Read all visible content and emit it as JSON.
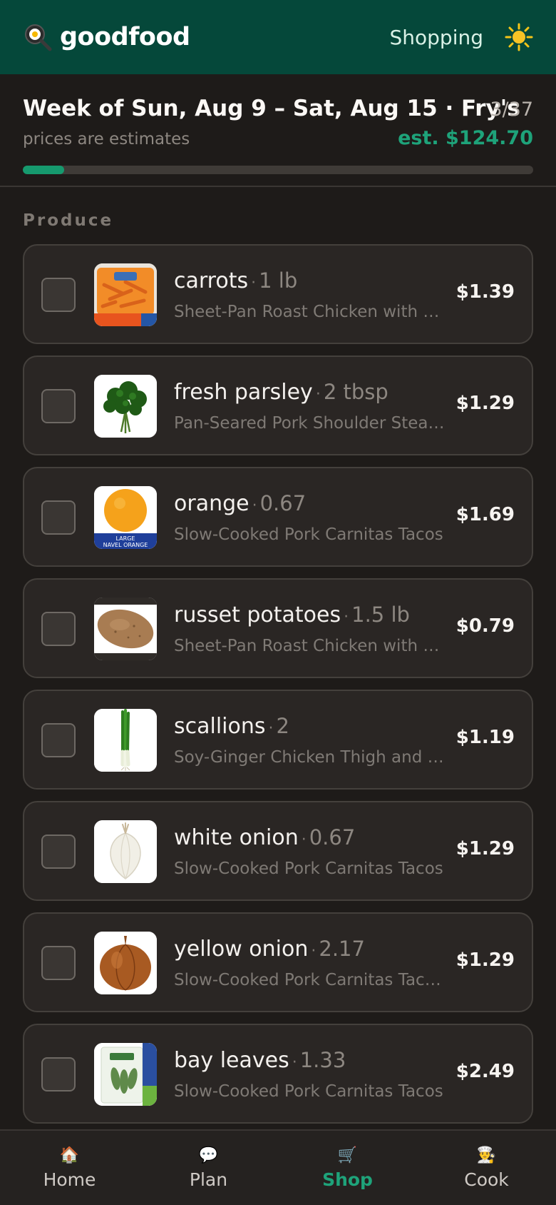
{
  "app": {
    "name": "goodfood",
    "mode": "Shopping"
  },
  "colors": {
    "topbar": "#05483a",
    "accent": "#1ea37a",
    "background": "#1e1b19",
    "card": "#2a2624"
  },
  "header": {
    "week": "Week of Sun, Aug 9 – Sat, Aug 15 · Fry's",
    "count": "3/37",
    "note": "prices are estimates",
    "estimate": "est. $124.70",
    "progress": 0.081
  },
  "section": {
    "title": "Produce"
  },
  "items": [
    {
      "name": "carrots",
      "qty": "1 lb",
      "recipe": "Sheet-Pan Roast Chicken with P…",
      "price": "$1.39",
      "image": "baby-carrots-bag",
      "checked": false
    },
    {
      "name": "fresh parsley",
      "qty": "2 tbsp",
      "recipe": "Pan-Seared Pork Shoulder Steak…",
      "price": "$1.29",
      "image": "parsley-bunch",
      "checked": false
    },
    {
      "name": "orange",
      "qty": "0.67",
      "recipe": "Slow-Cooked Pork Carnitas Tacos",
      "price": "$1.69",
      "image": "navel-orange",
      "image_text": "LARGE NAVEL ORANGE",
      "checked": false
    },
    {
      "name": "russet potatoes",
      "qty": "1.5 lb",
      "recipe": "Sheet-Pan Roast Chicken with P…",
      "price": "$0.79",
      "image": "russet-potato",
      "checked": false
    },
    {
      "name": "scallions",
      "qty": "2",
      "recipe": "Soy-Ginger Chicken Thigh and R…",
      "price": "$1.19",
      "image": "scallions",
      "checked": false
    },
    {
      "name": "white onion",
      "qty": "0.67",
      "recipe": "Slow-Cooked Pork Carnitas Tacos",
      "price": "$1.29",
      "image": "white-onion",
      "checked": false
    },
    {
      "name": "yellow onion",
      "qty": "2.17",
      "recipe": "Slow-Cooked Pork Carnitas Taco…",
      "price": "$1.29",
      "image": "yellow-onion",
      "checked": false
    },
    {
      "name": "bay leaves",
      "qty": "1.33",
      "recipe": "Slow-Cooked Pork Carnitas Tacos",
      "price": "$2.49",
      "image": "bay-leaves-pack",
      "checked": false
    }
  ],
  "nav": [
    {
      "label": "Home",
      "icon": "house-icon",
      "glyph": "🏠",
      "active": false
    },
    {
      "label": "Plan",
      "icon": "speech-bubble-icon",
      "glyph": "💬",
      "active": false
    },
    {
      "label": "Shop",
      "icon": "shopping-cart-icon",
      "glyph": "🛒",
      "active": true
    },
    {
      "label": "Cook",
      "icon": "chef-icon",
      "glyph": "👨‍🍳",
      "active": false
    }
  ]
}
